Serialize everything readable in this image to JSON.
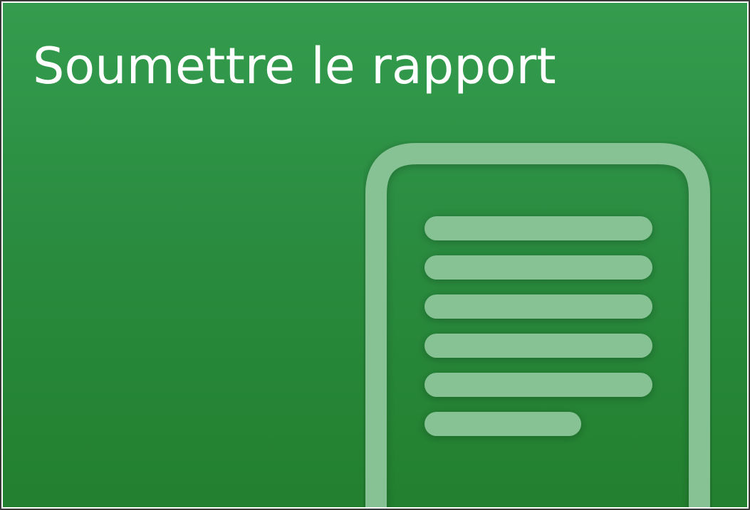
{
  "tile": {
    "title": "Soumettre le rapport",
    "icon": "document-icon",
    "background_color": "#2a8c40",
    "icon_color": "#86c294"
  }
}
